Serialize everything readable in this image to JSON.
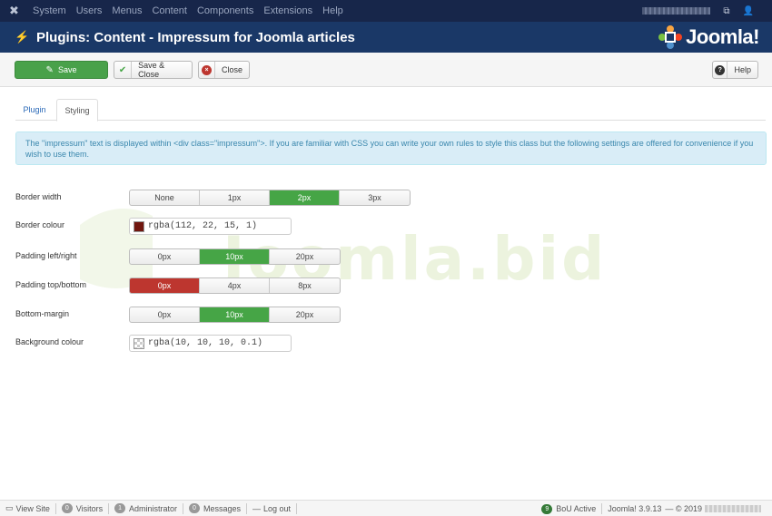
{
  "topnav": {
    "menu": [
      "System",
      "Users",
      "Menus",
      "Content",
      "Components",
      "Extensions",
      "Help"
    ]
  },
  "header": {
    "title": "Plugins: Content - Impressum for Joomla articles",
    "brand": "Joomla!"
  },
  "toolbar": {
    "save": "Save",
    "save_close": "Save & Close",
    "close": "Close",
    "help": "Help"
  },
  "tabs": {
    "plugin": "Plugin",
    "styling": "Styling"
  },
  "info": "The \"impressum\" text is displayed within <div class=\"impressum\">. If you are familiar with CSS you can write your own rules to style this class but the following settings are offered for convenience if you wish to use them.",
  "watermark": "Joomla.bid",
  "form": {
    "border_width": {
      "label": "Border width",
      "options": [
        "None",
        "1px",
        "2px",
        "3px"
      ],
      "selected": "2px"
    },
    "border_colour": {
      "label": "Border colour",
      "value": "rgba(112, 22, 15, 1)",
      "swatch": "#70160f"
    },
    "padding_lr": {
      "label": "Padding left/right",
      "options": [
        "0px",
        "10px",
        "20px"
      ],
      "selected": "10px"
    },
    "padding_tb": {
      "label": "Padding top/bottom",
      "options": [
        "0px",
        "4px",
        "8px"
      ],
      "selected": "0px"
    },
    "bottom_margin": {
      "label": "Bottom-margin",
      "options": [
        "0px",
        "10px",
        "20px"
      ],
      "selected": "10px"
    },
    "background_colour": {
      "label": "Background colour",
      "value": "rgba(10, 10, 10, 0.1)"
    }
  },
  "status": {
    "view_site": "View Site",
    "visitors_count": "0",
    "visitors": "Visitors",
    "admin_count": "1",
    "admin": "Administrator",
    "messages_count": "0",
    "messages": "Messages",
    "logout": "Log out",
    "bou_count": "9",
    "bou": "BoU Active",
    "version": "Joomla! 3.9.13",
    "copyright": "— © 2019"
  },
  "colors": {
    "green": "#46a546",
    "red": "#bd362f",
    "navy": "#1a3867"
  }
}
